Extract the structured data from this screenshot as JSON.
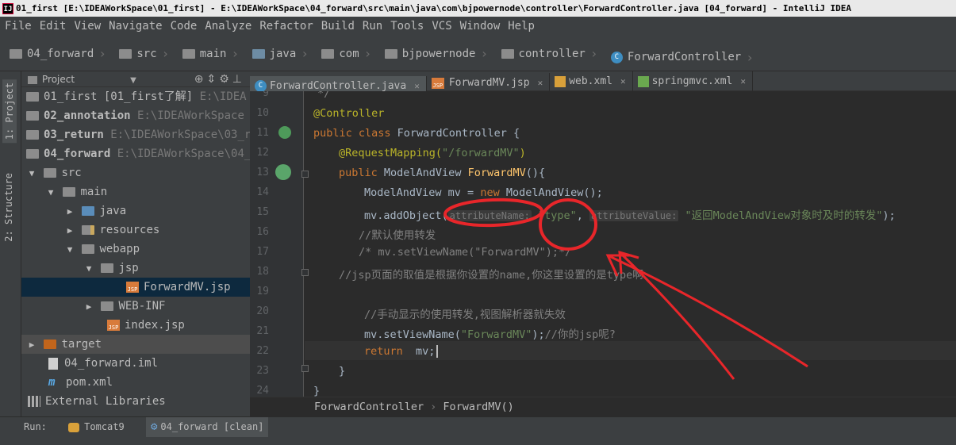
{
  "title_bar": {
    "app_icon": "IJ",
    "text": "01_first [E:\\IDEAWorkSpace\\01_first] - E:\\IDEAWorkSpace\\04_forward\\src\\main\\java\\com\\bjpowernode\\controller\\ForwardController.java [04_forward] - IntelliJ IDEA"
  },
  "menu": [
    "File",
    "Edit",
    "View",
    "Navigate",
    "Code",
    "Analyze",
    "Refactor",
    "Build",
    "Run",
    "Tools",
    "VCS",
    "Window",
    "Help"
  ],
  "nav_breadcrumb": [
    "04_forward",
    "src",
    "main",
    "java",
    "com",
    "bjpowernode",
    "controller",
    "ForwardController"
  ],
  "left_tool_tabs": [
    "1: Project",
    "2: Structure"
  ],
  "project_panel": {
    "title": "Project",
    "tool_icons": [
      "target-icon",
      "collapse-icon",
      "gear-icon",
      "hide-icon"
    ],
    "tree": [
      {
        "label": "01_first",
        "extra": "[01_first了解]",
        "path": "E:\\IDEA",
        "bold": false
      },
      {
        "label": "02_annotation",
        "extra": "",
        "path": "E:\\IDEAWorkSpace",
        "bold": true
      },
      {
        "label": "03_return",
        "extra": "",
        "path": "E:\\IDEAWorkSpace\\03_r",
        "bold": true
      },
      {
        "label": "04_forward",
        "extra": "",
        "path": "E:\\IDEAWorkSpace\\04_f",
        "bold": true
      },
      {
        "label": "src"
      },
      {
        "label": "main"
      },
      {
        "label": "java"
      },
      {
        "label": "resources"
      },
      {
        "label": "webapp"
      },
      {
        "label": "jsp"
      },
      {
        "label": "ForwardMV.jsp"
      },
      {
        "label": "WEB-INF"
      },
      {
        "label": "index.jsp"
      },
      {
        "label": "target"
      },
      {
        "label": "04_forward.iml"
      },
      {
        "label": "pom.xml"
      },
      {
        "label": "External Libraries"
      }
    ],
    "file_badge": "JSP"
  },
  "editor_tabs": [
    {
      "label": "ForwardController.java",
      "active": true
    },
    {
      "label": "ForwardMV.jsp",
      "active": false
    },
    {
      "label": "web.xml",
      "active": false
    },
    {
      "label": "springmvc.xml",
      "active": false
    }
  ],
  "code": {
    "line_numbers": [
      "9",
      "10",
      "11",
      "12",
      "13",
      "14",
      "15",
      "16",
      "17",
      "18",
      "19",
      "20",
      "21",
      "22",
      "23",
      "24"
    ],
    "l9": "*/",
    "l10": "@Controller",
    "l11_kw": "public class",
    "l11_rest": " ForwardController {",
    "l12_ann": "@RequestMapping(",
    "l12_str": "\"/forwardMV\"",
    "l12_end": ")",
    "l13_kw": "public",
    "l13_type": " ModelAndView ",
    "l13_fn": "ForwardMV",
    "l13_end": "(){",
    "l14_a": "ModelAndView mv = ",
    "l14_kw": "new",
    "l14_b": " ModelAndView();",
    "l15_a": "mv.addObject(",
    "l15_hint1": "attributeName:",
    "l15_str1": "\"type\"",
    "l15_comma": ", ",
    "l15_hint2": "attributeValue:",
    "l15_str2": "\"返回ModelAndView对象时及时的转发\"",
    "l15_end": ");",
    "l16": "//默认使用转发",
    "l17": "/* mv.setViewName(\"ForwardMV\");*/",
    "l18": "//jsp页面的取值是根据你设置的name,你这里设置的是type啊",
    "l20": "//手动显示的使用转发,视图解析器就失效",
    "l21_a": "mv.setViewName(",
    "l21_str": "\"ForwardMV\"",
    "l21_b": ");",
    "l21_cmt": "//你的jsp呢?",
    "l22_kw": "return",
    "l22_rest": "  mv;",
    "l23": "}",
    "l24": "}"
  },
  "editor_breadcrumb": [
    "ForwardController",
    "ForwardMV()"
  ],
  "run_bar": {
    "label": "Run:",
    "tabs": [
      "Tomcat9",
      "04_forward [clean]"
    ]
  },
  "colors": {
    "annotation_red": "#e8262a",
    "keyword": "#cc7832",
    "string": "#6a8759",
    "comment": "#808080"
  }
}
